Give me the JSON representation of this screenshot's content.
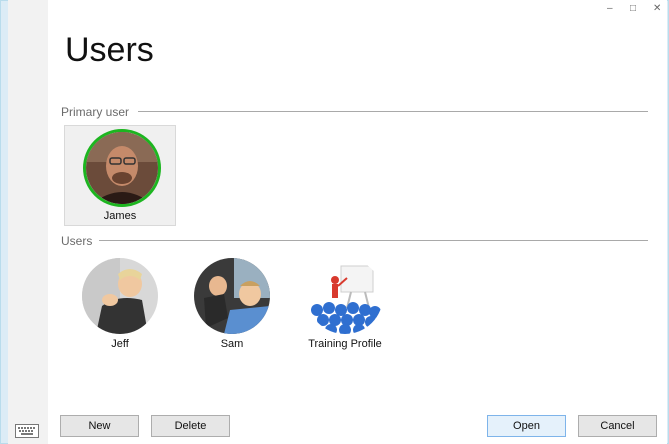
{
  "title": "Users",
  "window_controls": {
    "minimize": "–",
    "maximize": "□",
    "close": "✕"
  },
  "primary_section": {
    "label": "Primary user"
  },
  "users_section": {
    "label": "Users"
  },
  "primary_user": {
    "name": "James",
    "ring_color": "#1db520"
  },
  "users": [
    {
      "name": "Jeff"
    },
    {
      "name": "Sam"
    },
    {
      "name": "Training Profile"
    }
  ],
  "buttons": {
    "new": "New",
    "delete": "Delete",
    "open": "Open",
    "cancel": "Cancel"
  },
  "icons": {
    "keyboard": "keyboard-icon"
  }
}
